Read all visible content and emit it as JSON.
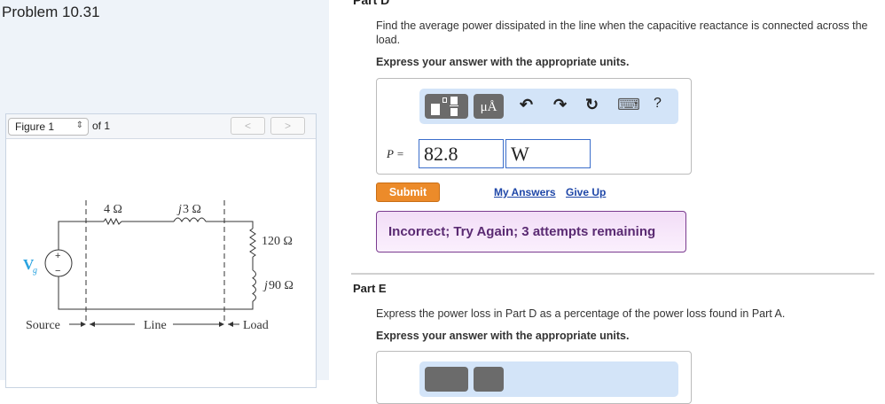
{
  "problem": {
    "title": "Problem 10.31"
  },
  "figure": {
    "select_label": "Figure 1",
    "of_label": "of 1",
    "prev": "<",
    "next": ">",
    "labels": {
      "r_line": "4 Ω",
      "x_line_j": "j",
      "x_line": "3 Ω",
      "r_load": "120 Ω",
      "x_load_j": "j",
      "x_load": "90 Ω",
      "source_v": "V",
      "source_sub": "g",
      "plus": "+",
      "minus": "−",
      "source": "Source",
      "line": "Line",
      "load": "Load"
    }
  },
  "partD": {
    "title": "Part D",
    "question": "Find the average power dissipated in the line when the capacitive reactance is connected across the load.",
    "instruction": "Express your answer with the appropriate units.",
    "toolbar": {
      "units_btn": "μÅ",
      "undo": "↶",
      "redo": "↷",
      "reset": "↻",
      "keyboard": "⌨",
      "help": "?"
    },
    "var_label": "P =",
    "value": "82.8",
    "unit": "W",
    "submit": "Submit",
    "my_answers": "My Answers",
    "give_up": "Give Up",
    "feedback": "Incorrect; Try Again; 3 attempts remaining"
  },
  "partE": {
    "title": "Part E",
    "question": "Express the power loss in Part D as a percentage of the power loss found in Part A.",
    "instruction": "Express your answer with the appropriate units."
  }
}
